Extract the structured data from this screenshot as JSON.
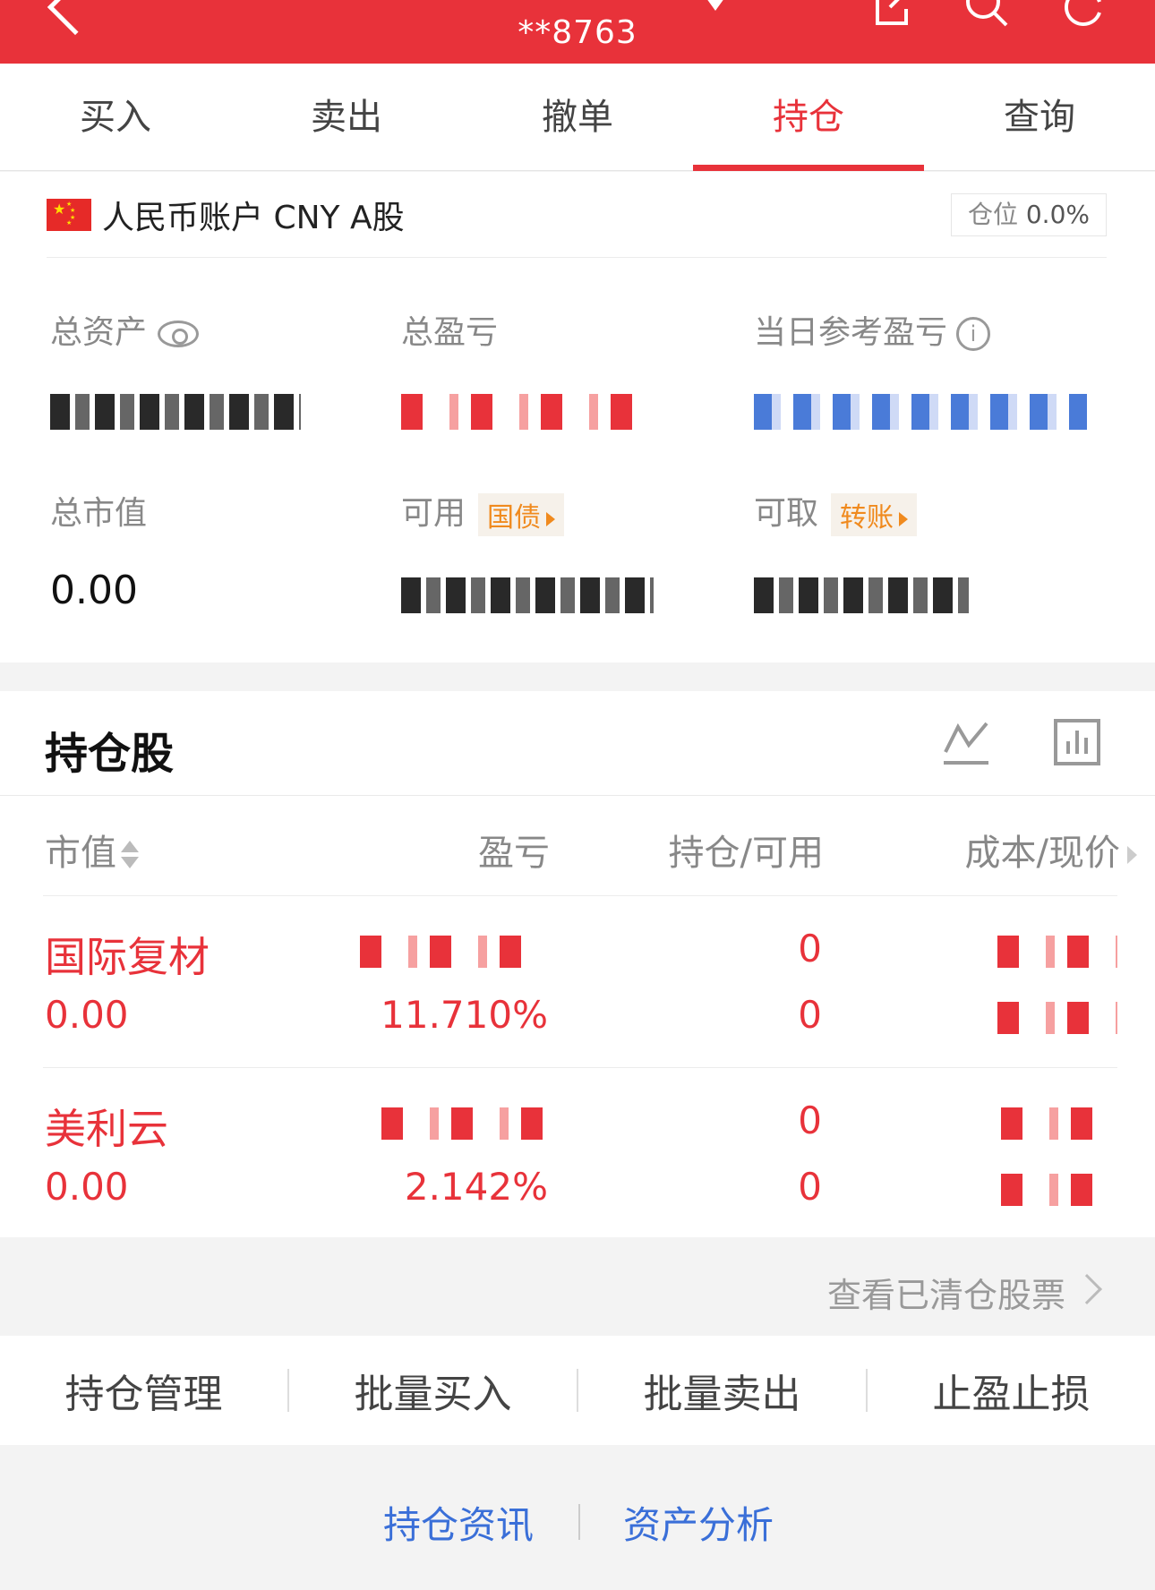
{
  "header": {
    "account_masked": "**8763",
    "colors": {
      "brand": "#e8323a",
      "link": "#3a6fd8",
      "tag": "#f08a1e"
    }
  },
  "tabs": [
    {
      "label": "买入",
      "active": false
    },
    {
      "label": "卖出",
      "active": false
    },
    {
      "label": "撤单",
      "active": false
    },
    {
      "label": "持仓",
      "active": true
    },
    {
      "label": "查询",
      "active": false
    }
  ],
  "account": {
    "name": "人民币账户 CNY A股",
    "position_label": "仓位",
    "position_value": "0.0%"
  },
  "summary": {
    "total_assets_label": "总资产",
    "total_pl_label": "总盈亏",
    "daily_pl_label": "当日参考盈亏",
    "market_value_label": "总市值",
    "market_value": "0.00",
    "available_label": "可用",
    "available_tag": "国债",
    "withdrawable_label": "可取",
    "withdrawable_tag": "转账"
  },
  "holdings": {
    "title": "持仓股",
    "columns": {
      "market_value": "市值",
      "pl": "盈亏",
      "qty": "持仓/可用",
      "cost": "成本/现价"
    },
    "rows": [
      {
        "name": "国际复材",
        "market_value": "0.00",
        "pl_pct": "11.710%",
        "qty": "0",
        "available": "0"
      },
      {
        "name": "美利云",
        "market_value": "0.00",
        "pl_pct": "2.142%",
        "qty": "0",
        "available": "0"
      }
    ]
  },
  "cleared_link": "查看已清仓股票",
  "actions": [
    "持仓管理",
    "批量买入",
    "批量卖出",
    "止盈止损"
  ],
  "bottom_links": [
    "持仓资讯",
    "资产分析"
  ]
}
